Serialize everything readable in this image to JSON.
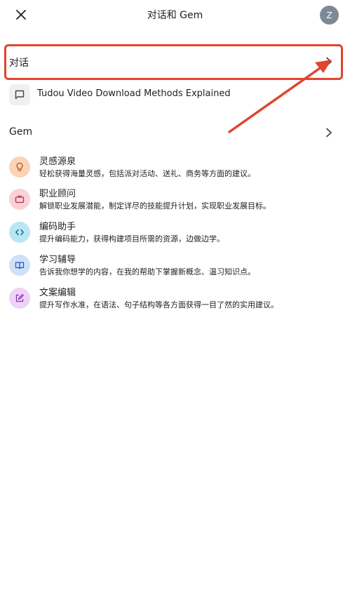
{
  "header": {
    "title": "对话和 Gem",
    "avatar_letter": "Z",
    "close_icon": "close-icon"
  },
  "conversations": {
    "label": "对话",
    "items": [
      {
        "title": "Tudou Video Download Methods Explained",
        "icon": "chat-icon"
      }
    ]
  },
  "gems": {
    "label": "Gem",
    "items": [
      {
        "name": "灵感源泉",
        "desc": "轻松获得海量灵感，包括派对活动、送礼、商务等方面的建议。",
        "icon": "lightbulb-icon",
        "bg": "#fbd3b5",
        "fg": "#b5541a"
      },
      {
        "name": "职业顾问",
        "desc": "解锁职业发展潜能，制定详尽的技能提升计划，实现职业发展目标。",
        "icon": "briefcase-icon",
        "bg": "#fbd0d8",
        "fg": "#b33050"
      },
      {
        "name": "编码助手",
        "desc": "提升编码能力，获得构建项目所需的资源，边做边学。",
        "icon": "code-icon",
        "bg": "#b8e6f4",
        "fg": "#0a6c8a"
      },
      {
        "name": "学习辅导",
        "desc": "告诉我你想学的内容，在我的帮助下掌握新概念、温习知识点。",
        "icon": "book-icon",
        "bg": "#cfe0f8",
        "fg": "#1c5ab5"
      },
      {
        "name": "文案编辑",
        "desc": "提升写作水准，在语法、句子结构等各方面获得一目了然的实用建议。",
        "icon": "edit-icon",
        "bg": "#ecd3f7",
        "fg": "#8a2fb0"
      }
    ]
  },
  "colors": {
    "highlight": "#e0452e",
    "arrow": "#e0452e"
  }
}
